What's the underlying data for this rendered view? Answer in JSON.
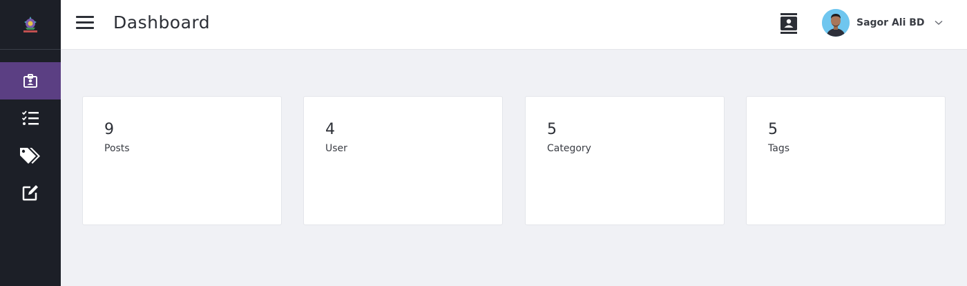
{
  "sidebar": {
    "logo": "logo-icon",
    "items": [
      {
        "name": "dashboard",
        "icon": "id-badge-icon",
        "active": true
      },
      {
        "name": "posts",
        "icon": "checklist-icon",
        "active": false
      },
      {
        "name": "tags",
        "icon": "tags-icon",
        "active": false
      },
      {
        "name": "edit",
        "icon": "edit-icon",
        "active": false
      }
    ]
  },
  "header": {
    "title": "Dashboard",
    "user_name": "Sagor Ali BD"
  },
  "stats": [
    {
      "value": "9",
      "label": "Posts"
    },
    {
      "value": "4",
      "label": "User"
    },
    {
      "value": "5",
      "label": "Category"
    },
    {
      "value": "5",
      "label": "Tags"
    }
  ],
  "colors": {
    "sidebar_bg": "#1c1f27",
    "active_nav": "#5b3f83",
    "page_bg": "#f0f1f5"
  }
}
